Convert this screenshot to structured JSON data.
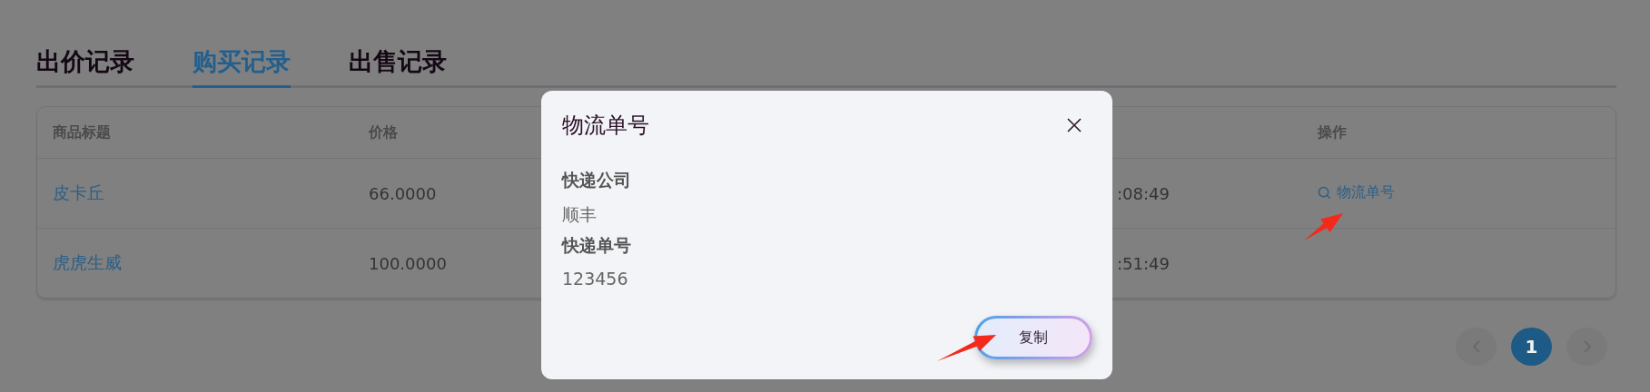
{
  "tabs": [
    {
      "label": "出价记录",
      "selected": false
    },
    {
      "label": "购买记录",
      "selected": true
    },
    {
      "label": "出售记录",
      "selected": false
    }
  ],
  "table": {
    "headers": {
      "title": "商品标题",
      "price": "价格",
      "action": "操作"
    },
    "rows": [
      {
        "title": "皮卡丘",
        "price": "66.0000",
        "column_3": ":08:49",
        "action": "物流单号"
      },
      {
        "title": "虎虎生威",
        "price": "100.0000",
        "column_3": ":51:49"
      }
    ]
  },
  "pagination": {
    "pages": [
      {
        "label": "1",
        "selected": true
      }
    ]
  },
  "dialog": {
    "title": "物流单号",
    "fields": [
      {
        "label": "快递公司",
        "value": "顺丰"
      },
      {
        "label": "快递单号",
        "value": "123456"
      }
    ],
    "button": "复制"
  }
}
